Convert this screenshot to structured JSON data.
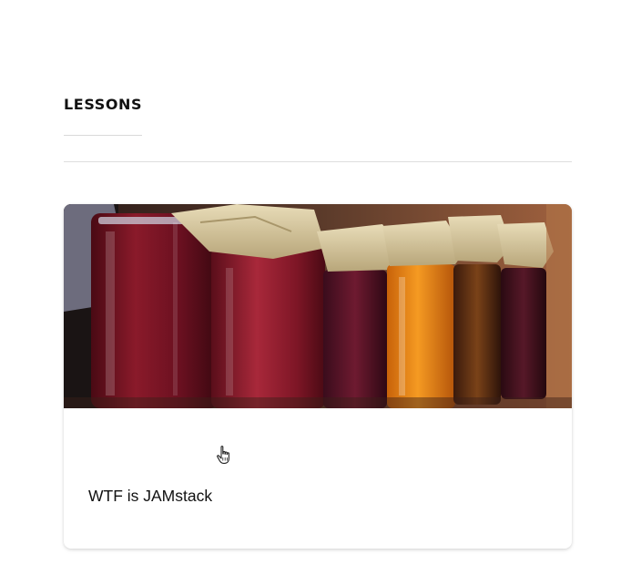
{
  "lessons": {
    "heading": "LESSONS",
    "items": [
      {
        "title": "WTF is JAMstack",
        "image": "jam-jars-photo"
      }
    ]
  },
  "cursor": {
    "icon": "hand-pointer-icon"
  }
}
